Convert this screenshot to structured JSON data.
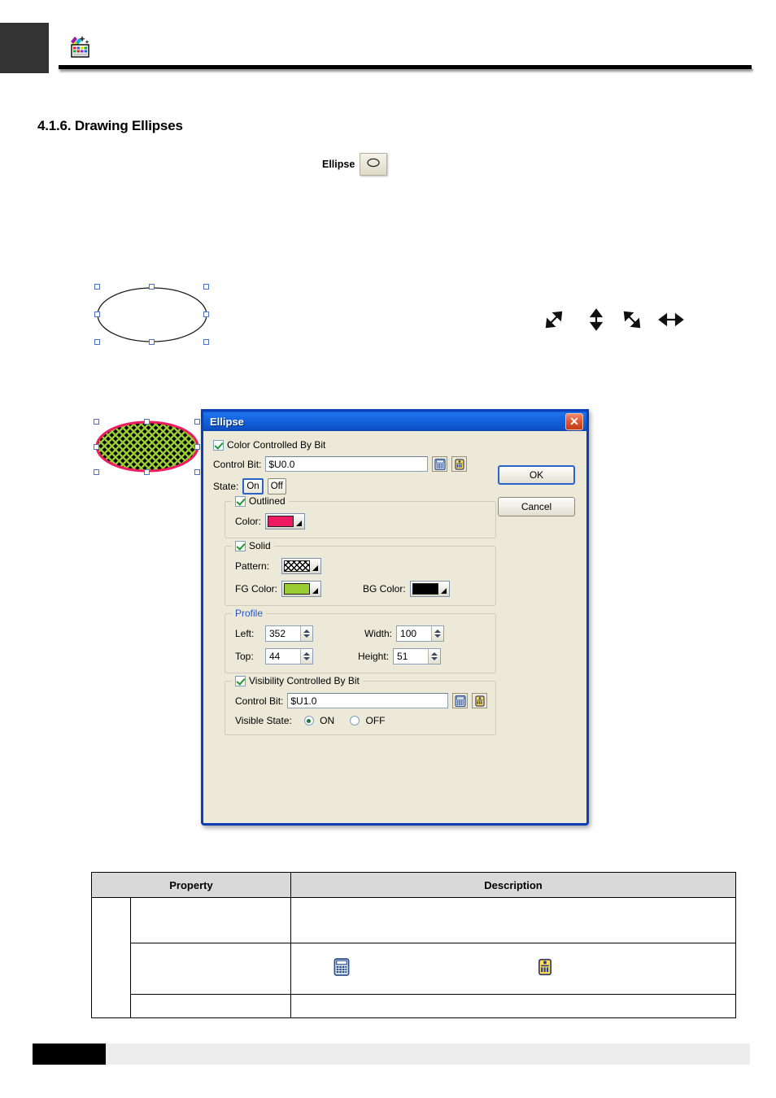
{
  "page": {
    "section_number_title": "4.1.6. Drawing Ellipses",
    "header_logo_icon": "paint-palette-icon"
  },
  "toolbar": {
    "ellipse_label": "Ellipse",
    "ellipse_button_icon": "ellipse-shape-icon"
  },
  "canvas": {
    "plain_ellipse": {
      "name": "plain-ellipse-shape",
      "stroke": "#1a1a1a",
      "fill": "#ffffff"
    },
    "patterned_ellipse": {
      "name": "patterned-ellipse-shape",
      "outline_color": "#ee1b63",
      "bg_color": "#000000",
      "fg_color": "#9acd32"
    },
    "selection_handle_color": "#4a73c8",
    "cursors": [
      {
        "name": "resize-diagonal-ne-sw-cursor"
      },
      {
        "name": "resize-vertical-cursor"
      },
      {
        "name": "resize-diagonal-nw-se-cursor"
      },
      {
        "name": "resize-horizontal-cursor"
      }
    ]
  },
  "dialog": {
    "title": "Ellipse",
    "close_icon": "✕",
    "color_controlled_by_bit": {
      "label": "Color Controlled By Bit",
      "checked": true
    },
    "control_bit": {
      "label": "Control Bit:",
      "value": "$U0.0",
      "keypad_icon": "calculator-icon",
      "tag_icon": "tag-icon"
    },
    "state": {
      "label": "State:",
      "on_label": "On",
      "off_label": "Off",
      "selected": "On"
    },
    "outlined": {
      "legend": "Outlined",
      "checked": true,
      "color_label": "Color:",
      "color_value": "#ee1b63"
    },
    "solid": {
      "legend": "Solid",
      "checked": true,
      "pattern_label": "Pattern:",
      "pattern_value": "diagonal-crosshatch",
      "fg_label": "FG Color:",
      "fg_value": "#9acd32",
      "bg_label": "BG Color:",
      "bg_value": "#000000"
    },
    "profile": {
      "legend": "Profile",
      "left_label": "Left:",
      "left_value": "352",
      "width_label": "Width:",
      "width_value": "100",
      "top_label": "Top:",
      "top_value": "44",
      "height_label": "Height:",
      "height_value": "51"
    },
    "visibility": {
      "legend": "Visibility Controlled By Bit",
      "checked": true,
      "control_bit_label": "Control Bit:",
      "control_bit_value": "$U1.0",
      "visible_state_label": "Visible State:",
      "on_label": "ON",
      "off_label": "OFF",
      "selected": "ON",
      "keypad_icon": "calculator-icon",
      "tag_icon": "tag-icon"
    },
    "buttons": {
      "ok": "OK",
      "cancel": "Cancel"
    }
  },
  "table": {
    "headers": [
      "Property",
      "Description"
    ],
    "rows": [
      {
        "col1": "",
        "col2": "",
        "col3": ""
      },
      {
        "col1": "",
        "col2": "",
        "col3": "",
        "icons": [
          "calculator-icon",
          "tag-icon"
        ]
      },
      {
        "col1": "",
        "col2": "",
        "col3": ""
      }
    ]
  }
}
